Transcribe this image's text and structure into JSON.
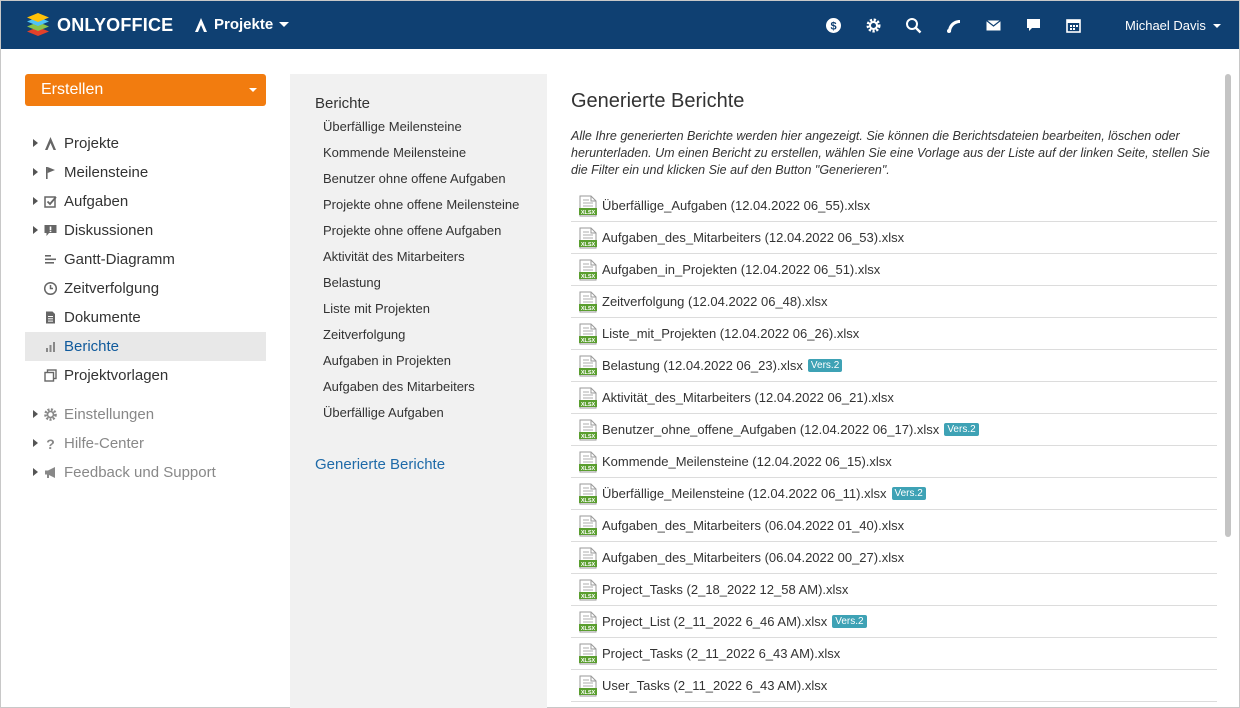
{
  "header": {
    "logo_text": "ONLYOFFICE",
    "module_label": "Projekte",
    "user_name": "Michael Davis",
    "icons": [
      "dollar-icon",
      "gear-icon",
      "search-icon",
      "feed-icon",
      "mail-icon",
      "chat-icon",
      "calendar-icon"
    ]
  },
  "sidebar": {
    "create_label": "Erstellen",
    "items": [
      {
        "label": "Projekte",
        "icon": "projects-icon",
        "expandable": true
      },
      {
        "label": "Meilensteine",
        "icon": "flag-icon",
        "expandable": true
      },
      {
        "label": "Aufgaben",
        "icon": "checkbox-icon",
        "expandable": true
      },
      {
        "label": "Diskussionen",
        "icon": "discussion-icon",
        "expandable": true
      },
      {
        "label": "Gantt-Diagramm",
        "icon": "gantt-icon",
        "expandable": false
      },
      {
        "label": "Zeitverfolgung",
        "icon": "clock-icon",
        "expandable": false
      },
      {
        "label": "Dokumente",
        "icon": "document-icon",
        "expandable": false
      },
      {
        "label": "Berichte",
        "icon": "bar-chart-icon",
        "expandable": false,
        "active": true
      },
      {
        "label": "Projektvorlagen",
        "icon": "template-icon",
        "expandable": false
      }
    ],
    "secondary": [
      {
        "label": "Einstellungen",
        "icon": "gear-icon"
      },
      {
        "label": "Hilfe-Center",
        "icon": "question-icon"
      },
      {
        "label": "Feedback und Support",
        "icon": "megaphone-icon"
      }
    ]
  },
  "reports_panel": {
    "title": "Berichte",
    "items": [
      "Überfällige Meilensteine",
      "Kommende Meilensteine",
      "Benutzer ohne offene Aufgaben",
      "Projekte ohne offene Meilensteine",
      "Projekte ohne offene Aufgaben",
      "Aktivität des Mitarbeiters",
      "Belastung",
      "Liste mit Projekten",
      "Zeitverfolgung",
      "Aufgaben in Projekten",
      "Aufgaben des Mitarbeiters",
      "Überfällige Aufgaben"
    ],
    "generated_label": "Generierte Berichte"
  },
  "main": {
    "title": "Generierte Berichte",
    "description": "Alle Ihre generierten Berichte werden hier angezeigt. Sie können die Berichtsdateien bearbeiten, löschen oder herunterladen. Um einen Bericht zu erstellen, wählen Sie eine Vorlage aus der Liste auf der linken Seite, stellen Sie die Filter ein und klicken Sie auf den Button \"Generieren\".",
    "files": [
      {
        "name": "Überfällige_Aufgaben (12.04.2022 06_55).xlsx",
        "badge": ""
      },
      {
        "name": "Aufgaben_des_Mitarbeiters (12.04.2022 06_53).xlsx",
        "badge": ""
      },
      {
        "name": "Aufgaben_in_Projekten (12.04.2022 06_51).xlsx",
        "badge": ""
      },
      {
        "name": "Zeitverfolgung (12.04.2022 06_48).xlsx",
        "badge": ""
      },
      {
        "name": "Liste_mit_Projekten (12.04.2022 06_26).xlsx",
        "badge": ""
      },
      {
        "name": "Belastung (12.04.2022 06_23).xlsx",
        "badge": "Vers.2"
      },
      {
        "name": "Aktivität_des_Mitarbeiters (12.04.2022 06_21).xlsx",
        "badge": ""
      },
      {
        "name": "Benutzer_ohne_offene_Aufgaben (12.04.2022 06_17).xlsx",
        "badge": "Vers.2"
      },
      {
        "name": "Kommende_Meilensteine (12.04.2022 06_15).xlsx",
        "badge": ""
      },
      {
        "name": "Überfällige_Meilensteine (12.04.2022 06_11).xlsx",
        "badge": "Vers.2"
      },
      {
        "name": "Aufgaben_des_Mitarbeiters (06.04.2022 01_40).xlsx",
        "badge": ""
      },
      {
        "name": "Aufgaben_des_Mitarbeiters (06.04.2022 00_27).xlsx",
        "badge": ""
      },
      {
        "name": "Project_Tasks (2_18_2022 12_58 AM).xlsx",
        "badge": ""
      },
      {
        "name": "Project_List (2_11_2022 6_46 AM).xlsx",
        "badge": "Vers.2"
      },
      {
        "name": "Project_Tasks (2_11_2022 6_43 AM).xlsx",
        "badge": ""
      },
      {
        "name": "User_Tasks (2_11_2022 6_43 AM).xlsx",
        "badge": ""
      }
    ],
    "file_icon_label": "XLSX"
  },
  "colors": {
    "header_bg": "#0f4072",
    "create_btn": "#f27c0f",
    "badge": "#3ea2b5",
    "link": "#1e6aa8",
    "xlsx_green": "#5a9e2f"
  }
}
